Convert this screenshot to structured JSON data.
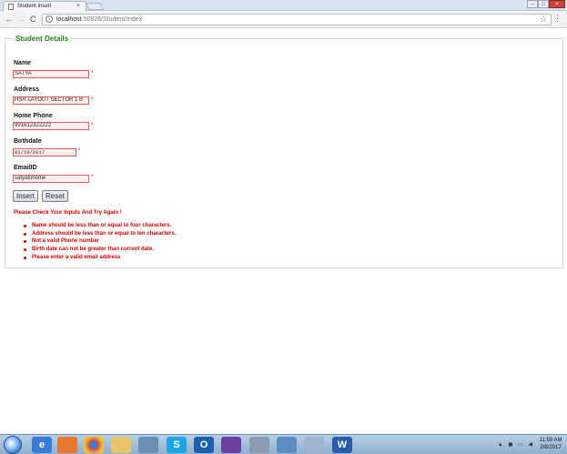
{
  "browser": {
    "tab_title": "Student Insert",
    "tab_close": "×",
    "url_host": "localhost",
    "url_path": ":50926/Student/Index",
    "back": "←",
    "forward": "→",
    "reload": "C",
    "info": "i",
    "star": "☆",
    "menu": "⋮",
    "win_min": "–",
    "win_max": "□",
    "win_close": "×"
  },
  "form": {
    "legend": "Student Details",
    "required_mark": "*",
    "fields": {
      "name": {
        "label": "Name",
        "value": "SATYA"
      },
      "address": {
        "label": "Address",
        "value": "HSR LAYOUT SECTOR 1 B"
      },
      "home_phone": {
        "label": "Home Phone",
        "value": "991612322222"
      },
      "birthdate": {
        "label": "Birthdate",
        "value": "02/10/2017"
      },
      "email": {
        "label": "EmailID",
        "value": "satyatohome"
      }
    },
    "insert_label": "Insert",
    "reset_label": "Reset"
  },
  "errors": {
    "header": "Please Check Your Inputs And Try Again !",
    "items": [
      "Name should be less than or equal to four characters.",
      "Address should be less than or equal to ten characters.",
      "Not a valid Phone number",
      "Birth date can not be greater than current date.",
      "Please enter a valid email address"
    ]
  },
  "taskbar": {
    "icons": [
      "internet-explorer-icon",
      "firefox-icon",
      "chrome-icon",
      "file-explorer-icon",
      "skype-icon",
      "outlook-icon",
      "visual-studio-icon",
      "tools-icon",
      "folder-icon",
      "settings-icon",
      "word-icon"
    ],
    "time": "11:59 AM",
    "date": "2/8/2017"
  }
}
